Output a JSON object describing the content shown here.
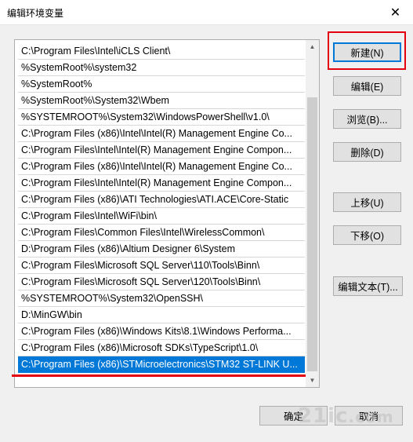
{
  "window": {
    "title": "编辑环境变量",
    "close_icon": "close-icon"
  },
  "paths": [
    "C:\\Program Files\\Intel\\iCLS Client\\",
    "%SystemRoot%\\system32",
    "%SystemRoot%",
    "%SystemRoot%\\System32\\Wbem",
    "%SYSTEMROOT%\\System32\\WindowsPowerShell\\v1.0\\",
    "C:\\Program Files (x86)\\Intel\\Intel(R) Management Engine Co...",
    "C:\\Program Files\\Intel\\Intel(R) Management Engine Compon...",
    "C:\\Program Files (x86)\\Intel\\Intel(R) Management Engine Co...",
    "C:\\Program Files\\Intel\\Intel(R) Management Engine Compon...",
    "C:\\Program Files (x86)\\ATI Technologies\\ATI.ACE\\Core-Static",
    "C:\\Program Files\\Intel\\WiFi\\bin\\",
    "C:\\Program Files\\Common Files\\Intel\\WirelessCommon\\",
    "D:\\Program Files (x86)\\Altium Designer 6\\System",
    "C:\\Program Files\\Microsoft SQL Server\\110\\Tools\\Binn\\",
    "C:\\Program Files\\Microsoft SQL Server\\120\\Tools\\Binn\\",
    "%SYSTEMROOT%\\System32\\OpenSSH\\",
    "D:\\MinGW\\bin",
    "C:\\Program Files (x86)\\Windows Kits\\8.1\\Windows Performa...",
    "C:\\Program Files (x86)\\Microsoft SDKs\\TypeScript\\1.0\\",
    "C:\\Program Files (x86)\\STMicroelectronics\\STM32 ST-LINK U..."
  ],
  "selected_index": 19,
  "buttons": {
    "new": "新建(N)",
    "edit": "编辑(E)",
    "browse": "浏览(B)...",
    "delete": "删除(D)",
    "move_up": "上移(U)",
    "move_down": "下移(O)",
    "edit_text": "编辑文本(T)...",
    "ok": "确定",
    "cancel": "取消"
  },
  "watermark": "21ic.com 电子网",
  "colors": {
    "selection": "#0078d7",
    "annotation_red": "#e3000f"
  }
}
